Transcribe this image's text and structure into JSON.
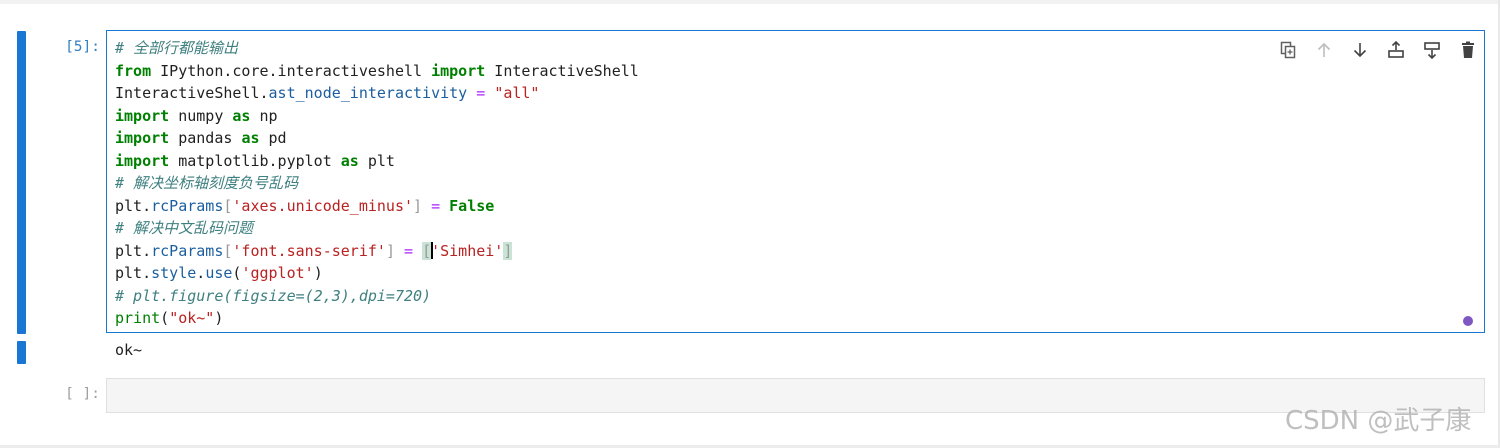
{
  "cell_1": {
    "prompt": "[5]:",
    "code_lines": [
      [
        {
          "t": "# 全部行都能输出",
          "c": "c"
        }
      ],
      [
        {
          "t": "from",
          "c": "kw"
        },
        {
          "t": " IPython.core.interactiveshell "
        },
        {
          "t": "import",
          "c": "kw"
        },
        {
          "t": " InteractiveShell"
        }
      ],
      [
        {
          "t": "InteractiveShell."
        },
        {
          "t": "ast_node_interactivity",
          "c": "a"
        },
        {
          "t": " "
        },
        {
          "t": "=",
          "c": "eq"
        },
        {
          "t": " "
        },
        {
          "t": "\"all\"",
          "c": "s"
        }
      ],
      [
        {
          "t": "import",
          "c": "kw"
        },
        {
          "t": " numpy "
        },
        {
          "t": "as",
          "c": "kw"
        },
        {
          "t": " np"
        }
      ],
      [
        {
          "t": "import",
          "c": "kw"
        },
        {
          "t": " pandas "
        },
        {
          "t": "as",
          "c": "kw"
        },
        {
          "t": " pd"
        }
      ],
      [
        {
          "t": "import",
          "c": "kw"
        },
        {
          "t": " matplotlib.pyplot "
        },
        {
          "t": "as",
          "c": "kw"
        },
        {
          "t": " plt"
        }
      ],
      [
        {
          "t": "# 解决坐标轴刻度负号乱码",
          "c": "c"
        }
      ],
      [
        {
          "t": "plt."
        },
        {
          "t": "rcParams",
          "c": "a"
        },
        {
          "t": "[",
          "c": "br"
        },
        {
          "t": "'axes.unicode_minus'",
          "c": "s"
        },
        {
          "t": "]",
          "c": "br"
        },
        {
          "t": " "
        },
        {
          "t": "=",
          "c": "eq"
        },
        {
          "t": " "
        },
        {
          "t": "False",
          "c": "kw"
        }
      ],
      [
        {
          "t": "# 解决中文乱码问题",
          "c": "c"
        }
      ],
      [
        {
          "t": "plt."
        },
        {
          "t": "rcParams",
          "c": "a"
        },
        {
          "t": "[",
          "c": "br"
        },
        {
          "t": "'font.sans-serif'",
          "c": "s"
        },
        {
          "t": "]",
          "c": "br"
        },
        {
          "t": " "
        },
        {
          "t": "=",
          "c": "eq"
        },
        {
          "t": " "
        },
        {
          "t": "[",
          "c": "br hl"
        },
        {
          "t": "",
          "c": "cursor"
        },
        {
          "t": "'Simhei'",
          "c": "s"
        },
        {
          "t": "]",
          "c": "br hl"
        }
      ],
      [
        {
          "t": "plt."
        },
        {
          "t": "style",
          "c": "a"
        },
        {
          "t": "."
        },
        {
          "t": "use",
          "c": "a"
        },
        {
          "t": "("
        },
        {
          "t": "'ggplot'",
          "c": "s"
        },
        {
          "t": ")"
        }
      ],
      [
        {
          "t": "# plt.figure(figsize=(2,3),dpi=720)",
          "c": "c"
        }
      ],
      [
        {
          "t": "print",
          "c": "kw2"
        },
        {
          "t": "("
        },
        {
          "t": "\"ok~\"",
          "c": "s"
        },
        {
          "t": ")"
        }
      ]
    ],
    "output": "ok~"
  },
  "cell_2": {
    "prompt": "[ ]:"
  },
  "toolbar": {
    "icons": [
      "duplicate-cell-icon",
      "move-up-icon",
      "move-down-icon",
      "insert-above-icon",
      "insert-below-icon",
      "delete-cell-icon"
    ]
  },
  "watermark": "CSDN @武子康",
  "colors": {
    "accent": "#1976d2",
    "comment": "#408080",
    "keyword": "#008000",
    "string": "#ba2121",
    "operator": "#aa22ff"
  }
}
